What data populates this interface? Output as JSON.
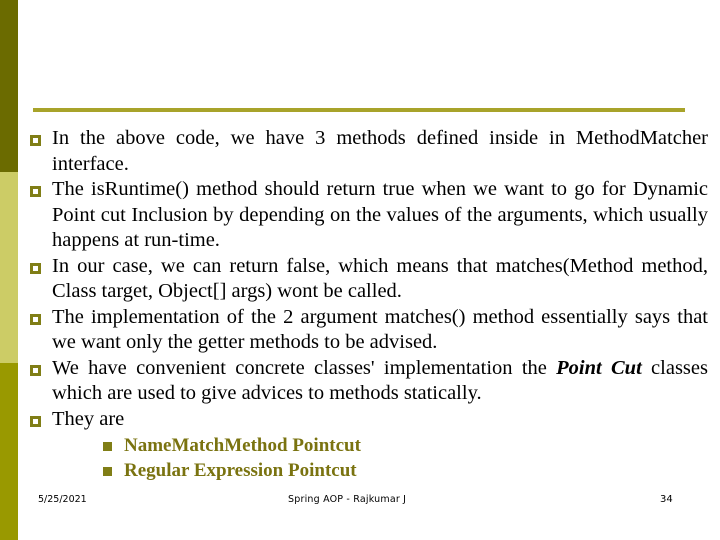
{
  "slide": {
    "page_number": "34",
    "accent_colors": {
      "band_top": "#6b6b00",
      "band_middle": "#cccc66",
      "band_bottom": "#999900",
      "title_rule": "#a8a32a",
      "bullet_marker": "#807e16",
      "sub_bullet_text": "#7a7310"
    }
  },
  "content": {
    "bullets": [
      {
        "text_before": "In the above code, we have 3 methods defined inside in MethodMatcher interface.",
        "emphasis": "",
        "text_after": ""
      },
      {
        "text_before": "The is",
        "emphasis": "",
        "text_after": ""
      },
      {
        "text_before": "In our case, we can return false, which means that matches(Method method, Class target, Object[] args) wont be called.",
        "emphasis": "",
        "text_after": ""
      },
      {
        "text_before": "The implementation of the 2 argument matches() method essentially says that we want only the getter methods to be advised.",
        "emphasis": "",
        "text_after": ""
      },
      {
        "text_before": "We have convenient concrete classes' implementation the ",
        "emphasis": "Point Cut",
        "text_after": " classes which are used to give advices to methods statically."
      },
      {
        "text_before": "They are",
        "emphasis": "",
        "text_after": ""
      }
    ],
    "bullet_1": "In the above code, we have 3 methods defined inside in MethodMatcher interface.",
    "bullet_2": "The isRuntime() method should return true when we want to go for Dynamic Point cut Inclusion by depending on the values of the arguments, which usually happens at run-time.",
    "bullet_3": "In our case, we can return false, which means that matches(Method method, Class target, Object[] args) wont be called.",
    "bullet_4": "The implementation of the 2 argument matches() method essentially says that we want only the getter methods to be advised.",
    "bullet_5_before": "We have convenient concrete classes' implementation the ",
    "bullet_5_emphasis": "Point Cut",
    "bullet_5_after": " classes which are used to give advices to methods statically.",
    "bullet_6": "They are",
    "sub_bullets": [
      "NameMatchMethod Pointcut",
      "Regular Expression Pointcut"
    ]
  },
  "footer": {
    "date": "5/25/2021",
    "center": "Spring AOP  -  Rajkumar J",
    "page": "34"
  }
}
